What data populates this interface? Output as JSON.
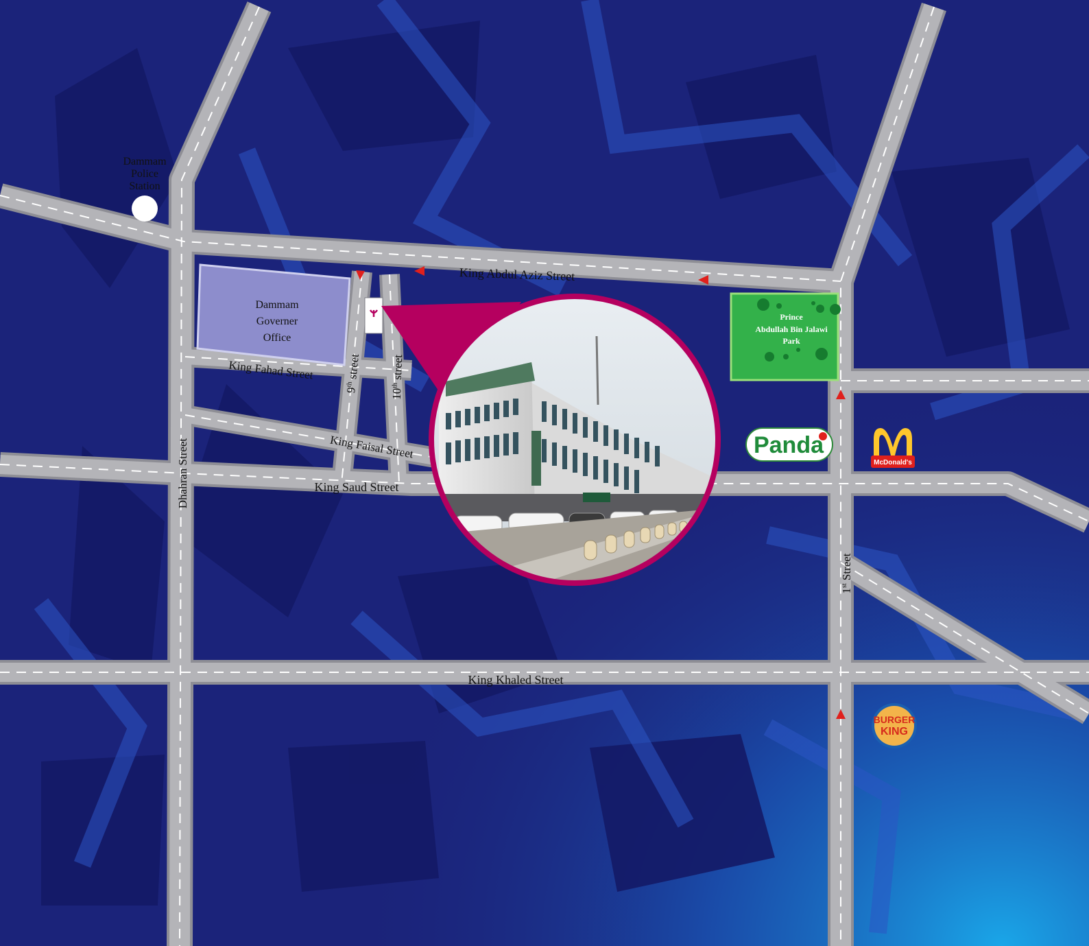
{
  "map": {
    "streets": {
      "king_abdul_aziz": "King Abdul Aziz Street",
      "king_fahad": "King Fahad Street",
      "king_faisal": "King Faisal Street",
      "king_saud": "King Saud Street",
      "king_khaled": "King Khaled Street",
      "dhahran": "Dhahran Street",
      "ninth": "9th street",
      "ninth_num": "9",
      "ninth_sup": "th",
      "ninth_word": " street",
      "tenth": "10th street",
      "tenth_num": "10",
      "tenth_sup": "th",
      "tenth_word": " street",
      "first": "1st Street",
      "first_num": "1",
      "first_sup": "st",
      "first_word": " Street"
    },
    "landmarks": {
      "police_station": {
        "line1": "Dammam",
        "line2": "Police",
        "line3": "Station"
      },
      "governor_office": {
        "line1": "Dammam",
        "line2": "Governer",
        "line3": "Office"
      },
      "park": {
        "line1": "Prince",
        "line2": "Abdullah Bin Jalawi",
        "line3": "Park"
      }
    },
    "brands": {
      "panda": "Panda",
      "mcdonalds": "McDonald's",
      "burger_king_top": "BURGER",
      "burger_king_bottom": "KING"
    },
    "colors": {
      "background": "#1b237a",
      "road": "#b4b4b8",
      "road_edge": "#8e8e95",
      "governor_block": "#8d8dcc",
      "park": "#33b14a",
      "callout": "#b5005f",
      "arrow": "#e0201c"
    }
  }
}
